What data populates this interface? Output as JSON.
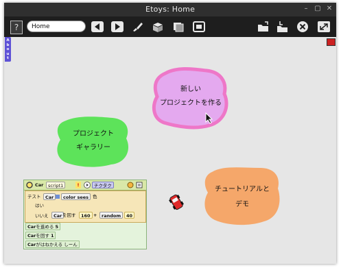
{
  "window": {
    "title": "Etoys: Home",
    "controls": [
      "–",
      "▢",
      "✕"
    ]
  },
  "toolbar": {
    "help_label": "?",
    "project_name": "Home",
    "buttons": [
      "back",
      "forward",
      "paint",
      "supplies",
      "language",
      "fullscreen-toggle",
      "open-project",
      "save-project",
      "quit",
      "fullscreen"
    ]
  },
  "about_flap": {
    "label": "About"
  },
  "home": {
    "new_project": {
      "line1": "新しい",
      "line2": "プロジェクトを作る",
      "color": "#e4a9ef",
      "border": "#ee77c8"
    },
    "gallery": {
      "line1": "プロジェクト",
      "line2": "ギャラリー",
      "color": "#5de35a"
    },
    "tutorial": {
      "line1": "チュートリアルと",
      "line2": "デモ",
      "color": "#f5a76a"
    }
  },
  "script": {
    "object": "Car",
    "name": "script1",
    "trigger": "チクタク",
    "test_label": "テスト",
    "yes_label": "はい",
    "no_label": "いいえ",
    "condition_obj": "Car",
    "condition_text": "color sees",
    "condition_tail": "色",
    "turn_tile": {
      "obj": "Car",
      "verb": "を回す",
      "value": "160",
      "op": "+",
      "fn": "random",
      "fn_arg": "40"
    },
    "standalone_tiles": [
      {
        "obj": "Car",
        "verb": "を進める",
        "value": "5"
      },
      {
        "obj": "Car",
        "verb": "を回す",
        "value": "1"
      },
      {
        "obj": "Car",
        "verb": "がはねかえる",
        "value": "しーん"
      }
    ]
  }
}
